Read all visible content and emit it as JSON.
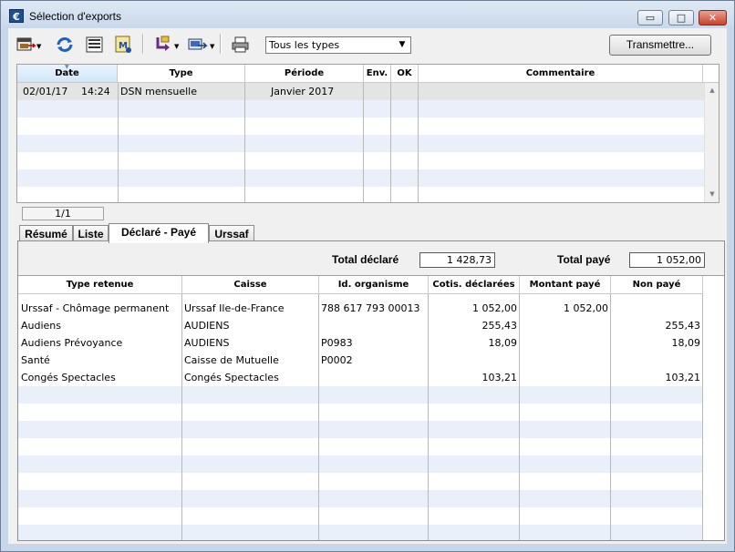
{
  "window": {
    "title": "Sélection d'exports",
    "app_icon_glyph": "€"
  },
  "titlebar_buttons": {
    "minimize": "▭",
    "maximize": "□",
    "close": "✕"
  },
  "toolbar": {
    "icons": [
      "open-export-icon",
      "refresh-icon",
      "list-view-icon",
      "certificate-icon",
      "import-icon",
      "export-icon",
      "print-icon"
    ],
    "type_filter": {
      "value": "Tous les types"
    },
    "transmit_label": "Transmettre..."
  },
  "exports_table": {
    "columns": [
      "Date",
      "Type",
      "Période",
      "Env.",
      "OK",
      "Commentaire"
    ],
    "rows": [
      {
        "date": "02/01/17",
        "time": "14:24",
        "type": "DSN mensuelle",
        "periode": "Janvier 2017",
        "env": "",
        "ok": "",
        "commentaire": ""
      }
    ],
    "pager": "1/1"
  },
  "tabs": [
    "Résumé",
    "Liste",
    "Déclaré - Payé",
    "Urssaf"
  ],
  "active_tab": "Déclaré - Payé",
  "totals": {
    "declared_label": "Total déclaré",
    "declared_value": "1 428,73",
    "paid_label": "Total payé",
    "paid_value": "1 052,00"
  },
  "detail_table": {
    "columns": [
      "Type retenue",
      "Caisse",
      "Id. organisme",
      "Cotis. déclarées",
      "Montant payé",
      "Non payé"
    ],
    "rows": [
      {
        "type": "Urssaf - Chômage permanent",
        "caisse": "Urssaf Ile-de-France",
        "id": "788 617 793 00013",
        "declarees": "1 052,00",
        "paye": "1 052,00",
        "non_paye": ""
      },
      {
        "type": "Audiens",
        "caisse": "AUDIENS",
        "id": "",
        "declarees": "255,43",
        "paye": "",
        "non_paye": "255,43"
      },
      {
        "type": "Audiens Prévoyance",
        "caisse": "AUDIENS",
        "id": "P0983",
        "declarees": "18,09",
        "paye": "",
        "non_paye": "18,09"
      },
      {
        "type": "Santé",
        "caisse": "Caisse de Mutuelle",
        "id": "P0002",
        "declarees": "",
        "paye": "",
        "non_paye": ""
      },
      {
        "type": "Congés Spectacles",
        "caisse": "Congés Spectacles",
        "id": "",
        "declarees": "103,21",
        "paye": "",
        "non_paye": "103,21"
      }
    ]
  },
  "colors": {
    "selected_header": "#cfe6f9",
    "row_alt": "#eaf0f9",
    "frame": "#c7d6e8"
  }
}
